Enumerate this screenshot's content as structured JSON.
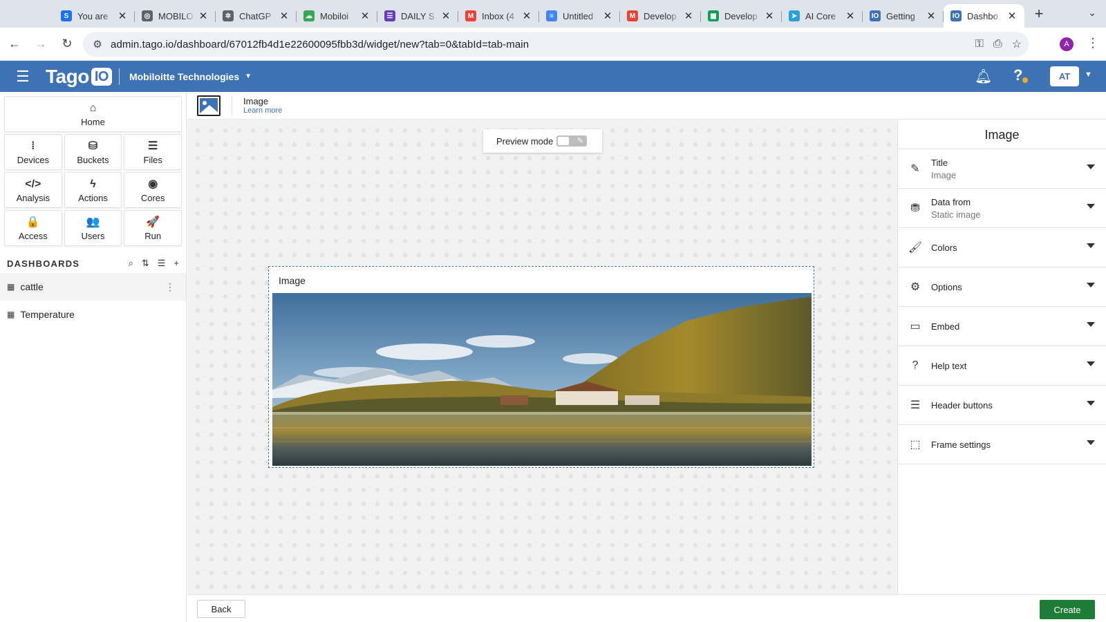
{
  "browser": {
    "tabs": [
      {
        "title": "You are",
        "icon": "s-doc-icon",
        "color": "#1a73e8",
        "glyph": "S"
      },
      {
        "title": "MOBILO",
        "icon": "globe-icon",
        "color": "#5f6368",
        "glyph": "◎"
      },
      {
        "title": "ChatGP",
        "icon": "chatgpt-icon",
        "color": "#5f6368",
        "glyph": "✲"
      },
      {
        "title": "Mobiloi",
        "icon": "cloud-icon",
        "color": "#34a853",
        "glyph": "☁"
      },
      {
        "title": "DAILY S",
        "icon": "form-icon",
        "color": "#673ab7",
        "glyph": "☰"
      },
      {
        "title": "Inbox (4",
        "icon": "gmail-icon",
        "color": "#ea4335",
        "glyph": "M"
      },
      {
        "title": "Untitled",
        "icon": "docs-icon",
        "color": "#4285f4",
        "glyph": "≡"
      },
      {
        "title": "Develop",
        "icon": "gmail-icon",
        "color": "#ea4335",
        "glyph": "M"
      },
      {
        "title": "Develop",
        "icon": "sheets-icon",
        "color": "#0f9d58",
        "glyph": "▦"
      },
      {
        "title": "AI Core",
        "icon": "telegram-icon",
        "color": "#2aa0da",
        "glyph": "➤"
      },
      {
        "title": "Getting",
        "icon": "tagoio-icon",
        "color": "#3d72b4",
        "glyph": "IO"
      },
      {
        "title": "Dashbo",
        "icon": "tagoio-icon",
        "color": "#3d72b4",
        "glyph": "IO"
      }
    ],
    "new_tab": "+",
    "url": "admin.tago.io/dashboard/67012fb4d1e22600095fbb3d/widget/new?tab=0&tabId=tab-main",
    "profile_initial": "A"
  },
  "app": {
    "logo_main": "Tago",
    "logo_io": "IO",
    "org": "Mobiloitte Technologies",
    "avatar": "AT"
  },
  "sidebar": {
    "home": "Home",
    "rows": [
      [
        {
          "label": "Devices",
          "icon": "devices-icon",
          "glyph": "⁞"
        },
        {
          "label": "Buckets",
          "icon": "buckets-icon",
          "glyph": "⛁"
        },
        {
          "label": "Files",
          "icon": "files-icon",
          "glyph": "☰"
        }
      ],
      [
        {
          "label": "Analysis",
          "icon": "analysis-icon",
          "glyph": "</>"
        },
        {
          "label": "Actions",
          "icon": "actions-icon",
          "glyph": "ϟ"
        },
        {
          "label": "Cores",
          "icon": "cores-icon",
          "glyph": "◉"
        }
      ],
      [
        {
          "label": "Access",
          "icon": "lock-icon",
          "glyph": "🔒"
        },
        {
          "label": "Users",
          "icon": "users-icon",
          "glyph": "👥"
        },
        {
          "label": "Run",
          "icon": "rocket-icon",
          "glyph": "🚀"
        }
      ]
    ],
    "dashboards_label": "DASHBOARDS",
    "dashboards": [
      "cattle",
      "Temperature"
    ]
  },
  "widget_bar": {
    "title": "Image",
    "learn_more": "Learn more"
  },
  "canvas": {
    "preview_label": "Preview mode",
    "widget_title": "Image"
  },
  "panel": {
    "title": "Image",
    "sections": [
      {
        "label": "Title",
        "value": "Image",
        "icon": "pencil-icon",
        "glyph": "✎"
      },
      {
        "label": "Data from",
        "value": "Static image",
        "icon": "database-icon",
        "glyph": "⛃"
      },
      {
        "label": "Colors",
        "value": "",
        "icon": "brush-icon",
        "glyph": "🖌"
      },
      {
        "label": "Options",
        "value": "",
        "icon": "gear-icon",
        "glyph": "⚙"
      },
      {
        "label": "Embed",
        "value": "",
        "icon": "embed-icon",
        "glyph": "▭"
      },
      {
        "label": "Help text",
        "value": "",
        "icon": "help-circle-icon",
        "glyph": "?"
      },
      {
        "label": "Header buttons",
        "value": "",
        "icon": "list-icon",
        "glyph": "☰"
      },
      {
        "label": "Frame settings",
        "value": "",
        "icon": "frame-icon",
        "glyph": "⬚"
      }
    ]
  },
  "footer": {
    "back": "Back",
    "create": "Create"
  }
}
